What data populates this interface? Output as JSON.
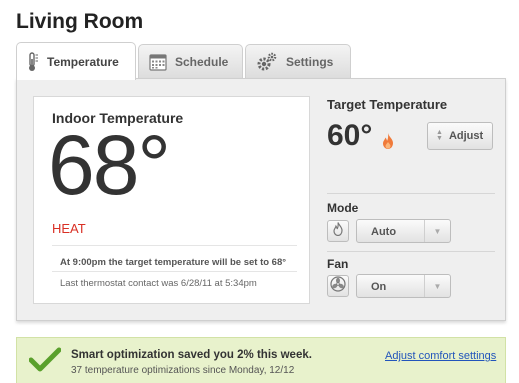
{
  "room": {
    "title": "Living Room"
  },
  "tabs": [
    {
      "label": "Temperature",
      "icon": "thermometer-icon",
      "active": true
    },
    {
      "label": "Schedule",
      "icon": "calendar-icon",
      "active": false
    },
    {
      "label": "Settings",
      "icon": "gears-icon",
      "active": false
    }
  ],
  "indoor": {
    "title": "Indoor Temperature",
    "value": "68°",
    "mode_status": "HEAT",
    "schedule_note": "At 9:00pm the target temperature will be set to 68°",
    "contact_note": "Last thermostat contact was 6/28/11 at 5:34pm"
  },
  "target": {
    "title": "Target Temperature",
    "value": "60°",
    "adjust_label": "Adjust"
  },
  "mode": {
    "label": "Mode",
    "value": "Auto"
  },
  "fan": {
    "label": "Fan",
    "value": "On"
  },
  "banner": {
    "message": "Smart optimization saved you 2% this week.",
    "sub_message": "37 temperature optimizations since Monday, 12/12",
    "link": "Adjust comfort settings"
  },
  "colors": {
    "heat": "#d93025",
    "flame": "#f07a3a",
    "check": "#5aa02c",
    "banner_bg": "#e8f2cc",
    "link": "#2255bb"
  }
}
